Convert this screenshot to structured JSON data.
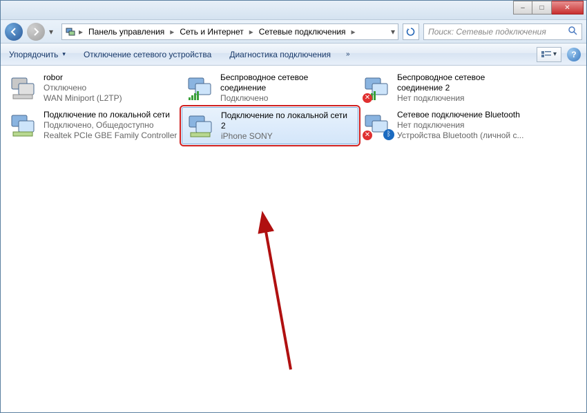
{
  "titlebar": {
    "minimize": "–",
    "maximize": "□",
    "close": "✕"
  },
  "breadcrumb": {
    "segs": [
      "Панель управления",
      "Сеть и Интернет",
      "Сетевые подключения"
    ]
  },
  "search": {
    "placeholder": "Поиск: Сетевые подключения"
  },
  "toolbar": {
    "organize": "Упорядочить",
    "disable": "Отключение сетевого устройства",
    "diagnose": "Диагностика подключения"
  },
  "connections": [
    {
      "name": "robor",
      "status": "Отключено",
      "detail": "WAN Miniport (L2TP)",
      "icon": "lan-disabled",
      "selected": false
    },
    {
      "name": "Беспроводное сетевое соединение",
      "status": "Подключено",
      "detail": "",
      "icon": "wifi-on",
      "selected": false
    },
    {
      "name": "Беспроводное сетевое соединение 2",
      "status": "Нет подключения",
      "detail": "",
      "icon": "wifi-off",
      "selected": false
    },
    {
      "name": "Подключение по локальной сети",
      "status": "Подключено, Общедоступно",
      "detail": "Realtek PCIe GBE Family Controller",
      "icon": "lan-on",
      "selected": false
    },
    {
      "name": "Подключение по локальной сети 2",
      "status": "",
      "detail": "iPhone SONY",
      "icon": "lan-on",
      "selected": true
    },
    {
      "name": "Сетевое подключение Bluetooth",
      "status": "Нет подключения",
      "detail": "Устройства Bluetooth (личной с...",
      "icon": "bluetooth-off",
      "selected": false
    }
  ]
}
